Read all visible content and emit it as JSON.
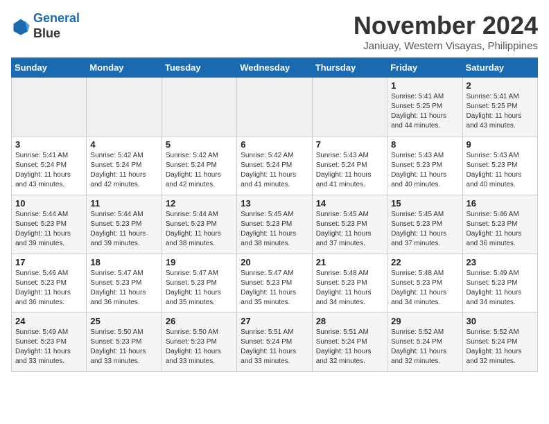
{
  "logo": {
    "line1": "General",
    "line2": "Blue"
  },
  "title": "November 2024",
  "subtitle": "Janiuay, Western Visayas, Philippines",
  "days_of_week": [
    "Sunday",
    "Monday",
    "Tuesday",
    "Wednesday",
    "Thursday",
    "Friday",
    "Saturday"
  ],
  "weeks": [
    [
      {
        "day": "",
        "info": ""
      },
      {
        "day": "",
        "info": ""
      },
      {
        "day": "",
        "info": ""
      },
      {
        "day": "",
        "info": ""
      },
      {
        "day": "",
        "info": ""
      },
      {
        "day": "1",
        "info": "Sunrise: 5:41 AM\nSunset: 5:25 PM\nDaylight: 11 hours\nand 44 minutes."
      },
      {
        "day": "2",
        "info": "Sunrise: 5:41 AM\nSunset: 5:25 PM\nDaylight: 11 hours\nand 43 minutes."
      }
    ],
    [
      {
        "day": "3",
        "info": "Sunrise: 5:41 AM\nSunset: 5:24 PM\nDaylight: 11 hours\nand 43 minutes."
      },
      {
        "day": "4",
        "info": "Sunrise: 5:42 AM\nSunset: 5:24 PM\nDaylight: 11 hours\nand 42 minutes."
      },
      {
        "day": "5",
        "info": "Sunrise: 5:42 AM\nSunset: 5:24 PM\nDaylight: 11 hours\nand 42 minutes."
      },
      {
        "day": "6",
        "info": "Sunrise: 5:42 AM\nSunset: 5:24 PM\nDaylight: 11 hours\nand 41 minutes."
      },
      {
        "day": "7",
        "info": "Sunrise: 5:43 AM\nSunset: 5:24 PM\nDaylight: 11 hours\nand 41 minutes."
      },
      {
        "day": "8",
        "info": "Sunrise: 5:43 AM\nSunset: 5:23 PM\nDaylight: 11 hours\nand 40 minutes."
      },
      {
        "day": "9",
        "info": "Sunrise: 5:43 AM\nSunset: 5:23 PM\nDaylight: 11 hours\nand 40 minutes."
      }
    ],
    [
      {
        "day": "10",
        "info": "Sunrise: 5:44 AM\nSunset: 5:23 PM\nDaylight: 11 hours\nand 39 minutes."
      },
      {
        "day": "11",
        "info": "Sunrise: 5:44 AM\nSunset: 5:23 PM\nDaylight: 11 hours\nand 39 minutes."
      },
      {
        "day": "12",
        "info": "Sunrise: 5:44 AM\nSunset: 5:23 PM\nDaylight: 11 hours\nand 38 minutes."
      },
      {
        "day": "13",
        "info": "Sunrise: 5:45 AM\nSunset: 5:23 PM\nDaylight: 11 hours\nand 38 minutes."
      },
      {
        "day": "14",
        "info": "Sunrise: 5:45 AM\nSunset: 5:23 PM\nDaylight: 11 hours\nand 37 minutes."
      },
      {
        "day": "15",
        "info": "Sunrise: 5:45 AM\nSunset: 5:23 PM\nDaylight: 11 hours\nand 37 minutes."
      },
      {
        "day": "16",
        "info": "Sunrise: 5:46 AM\nSunset: 5:23 PM\nDaylight: 11 hours\nand 36 minutes."
      }
    ],
    [
      {
        "day": "17",
        "info": "Sunrise: 5:46 AM\nSunset: 5:23 PM\nDaylight: 11 hours\nand 36 minutes."
      },
      {
        "day": "18",
        "info": "Sunrise: 5:47 AM\nSunset: 5:23 PM\nDaylight: 11 hours\nand 36 minutes."
      },
      {
        "day": "19",
        "info": "Sunrise: 5:47 AM\nSunset: 5:23 PM\nDaylight: 11 hours\nand 35 minutes."
      },
      {
        "day": "20",
        "info": "Sunrise: 5:47 AM\nSunset: 5:23 PM\nDaylight: 11 hours\nand 35 minutes."
      },
      {
        "day": "21",
        "info": "Sunrise: 5:48 AM\nSunset: 5:23 PM\nDaylight: 11 hours\nand 34 minutes."
      },
      {
        "day": "22",
        "info": "Sunrise: 5:48 AM\nSunset: 5:23 PM\nDaylight: 11 hours\nand 34 minutes."
      },
      {
        "day": "23",
        "info": "Sunrise: 5:49 AM\nSunset: 5:23 PM\nDaylight: 11 hours\nand 34 minutes."
      }
    ],
    [
      {
        "day": "24",
        "info": "Sunrise: 5:49 AM\nSunset: 5:23 PM\nDaylight: 11 hours\nand 33 minutes."
      },
      {
        "day": "25",
        "info": "Sunrise: 5:50 AM\nSunset: 5:23 PM\nDaylight: 11 hours\nand 33 minutes."
      },
      {
        "day": "26",
        "info": "Sunrise: 5:50 AM\nSunset: 5:23 PM\nDaylight: 11 hours\nand 33 minutes."
      },
      {
        "day": "27",
        "info": "Sunrise: 5:51 AM\nSunset: 5:24 PM\nDaylight: 11 hours\nand 33 minutes."
      },
      {
        "day": "28",
        "info": "Sunrise: 5:51 AM\nSunset: 5:24 PM\nDaylight: 11 hours\nand 32 minutes."
      },
      {
        "day": "29",
        "info": "Sunrise: 5:52 AM\nSunset: 5:24 PM\nDaylight: 11 hours\nand 32 minutes."
      },
      {
        "day": "30",
        "info": "Sunrise: 5:52 AM\nSunset: 5:24 PM\nDaylight: 11 hours\nand 32 minutes."
      }
    ]
  ]
}
